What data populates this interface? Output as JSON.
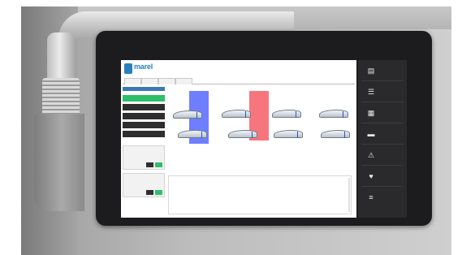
{
  "app": {
    "brand": "marel",
    "brand_sub": "",
    "header_info": [
      "",
      "",
      ""
    ],
    "header_right": [
      "",
      ""
    ]
  },
  "tabs": [
    {
      "label": ""
    },
    {
      "label": ""
    },
    {
      "label": ""
    },
    {
      "label": ""
    }
  ],
  "sidebar": {
    "title": "",
    "buttons": [
      {
        "label": "",
        "active": true
      },
      {
        "label": "",
        "active": false
      },
      {
        "label": "",
        "active": false
      },
      {
        "label": "",
        "active": false
      },
      {
        "label": "",
        "active": false
      }
    ],
    "control_boxes": [
      {
        "heading": "",
        "row1": "",
        "row2": "",
        "on_label": "",
        "off_label": ""
      },
      {
        "heading": "",
        "row1": "",
        "row2": "",
        "on_label": "",
        "off_label": ""
      }
    ]
  },
  "main": {
    "label": "",
    "log_title": "",
    "log_lines": [
      {
        "text": "",
        "color": "#2fbf6b"
      },
      {
        "text": "",
        "color": "#2fbf6b"
      },
      {
        "text": "",
        "color": "#2fbf6b"
      },
      {
        "text": "",
        "color": "#2fbf6b"
      },
      {
        "text": "",
        "color": "#444444"
      },
      {
        "text": "",
        "color": "#2fbf6b"
      },
      {
        "text": "",
        "color": "#444444"
      },
      {
        "text": "",
        "color": "#2fbf6b"
      },
      {
        "text": "",
        "color": "#444444"
      },
      {
        "text": "",
        "color": "#2fbf6b"
      },
      {
        "text": "",
        "color": "#444444"
      }
    ]
  },
  "right_panel": {
    "buttons": [
      {
        "icon": "calendar-icon",
        "label": ""
      },
      {
        "icon": "list-icon",
        "label": ""
      },
      {
        "icon": "table-icon",
        "label": ""
      },
      {
        "icon": "scale-icon",
        "label": ""
      },
      {
        "icon": "warning-icon",
        "label": ""
      },
      {
        "icon": "heart-icon",
        "label": ""
      },
      {
        "icon": "menu-icon",
        "label": ""
      }
    ]
  },
  "colors": {
    "accent_blue": "#3a78b8",
    "active_green": "#2fbf6b",
    "band_blue": "#4a5cff",
    "band_red": "#f5505a",
    "panel_dark": "#2a2a2c"
  }
}
